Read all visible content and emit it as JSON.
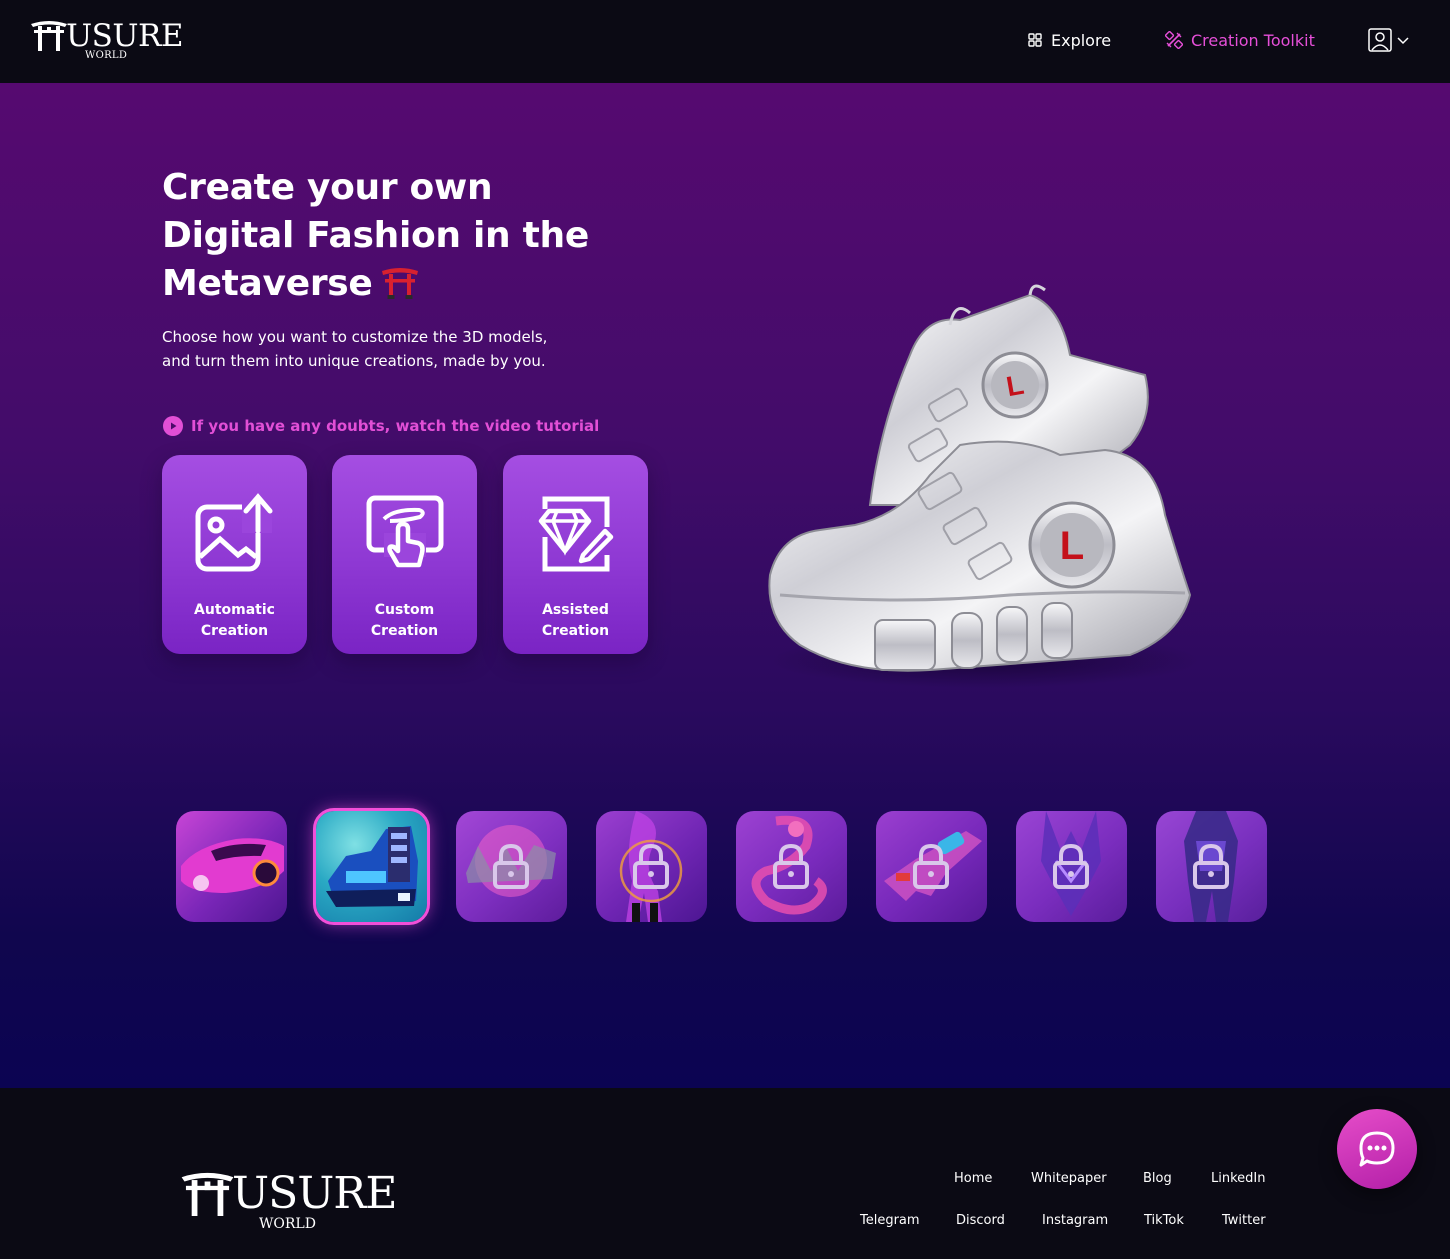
{
  "header": {
    "logo_text": "USURE",
    "logo_sub": "WORLD",
    "nav": {
      "explore_label": "Explore",
      "toolkit_label": "Creation Toolkit"
    }
  },
  "hero": {
    "headline_lines": [
      "Create your own",
      "Digital Fashion in the",
      "Metaverse"
    ],
    "description": "Choose how you want to customize the 3D models, and turn them into unique creations, made by you.",
    "tutorial_link": "If you have any doubts, watch the video tutorial",
    "cards": [
      {
        "line1": "Automatic",
        "line2": "Creation"
      },
      {
        "line1": "Custom",
        "line2": "Creation"
      },
      {
        "line1": "Assisted",
        "line2": "Creation"
      }
    ],
    "shoe_letter": "L"
  },
  "footer": {
    "logo_text": "USURE",
    "logo_sub": "WORLD",
    "links_row1": [
      "Home",
      "Whitepaper",
      "Blog",
      "LinkedIn"
    ],
    "links_row2": [
      "Telegram",
      "Discord",
      "Instagram",
      "TikTok",
      "Twitter"
    ]
  },
  "colors": {
    "accent": "#e24fd6",
    "card": "#9b45dc",
    "header_bg": "#0b0a14"
  }
}
